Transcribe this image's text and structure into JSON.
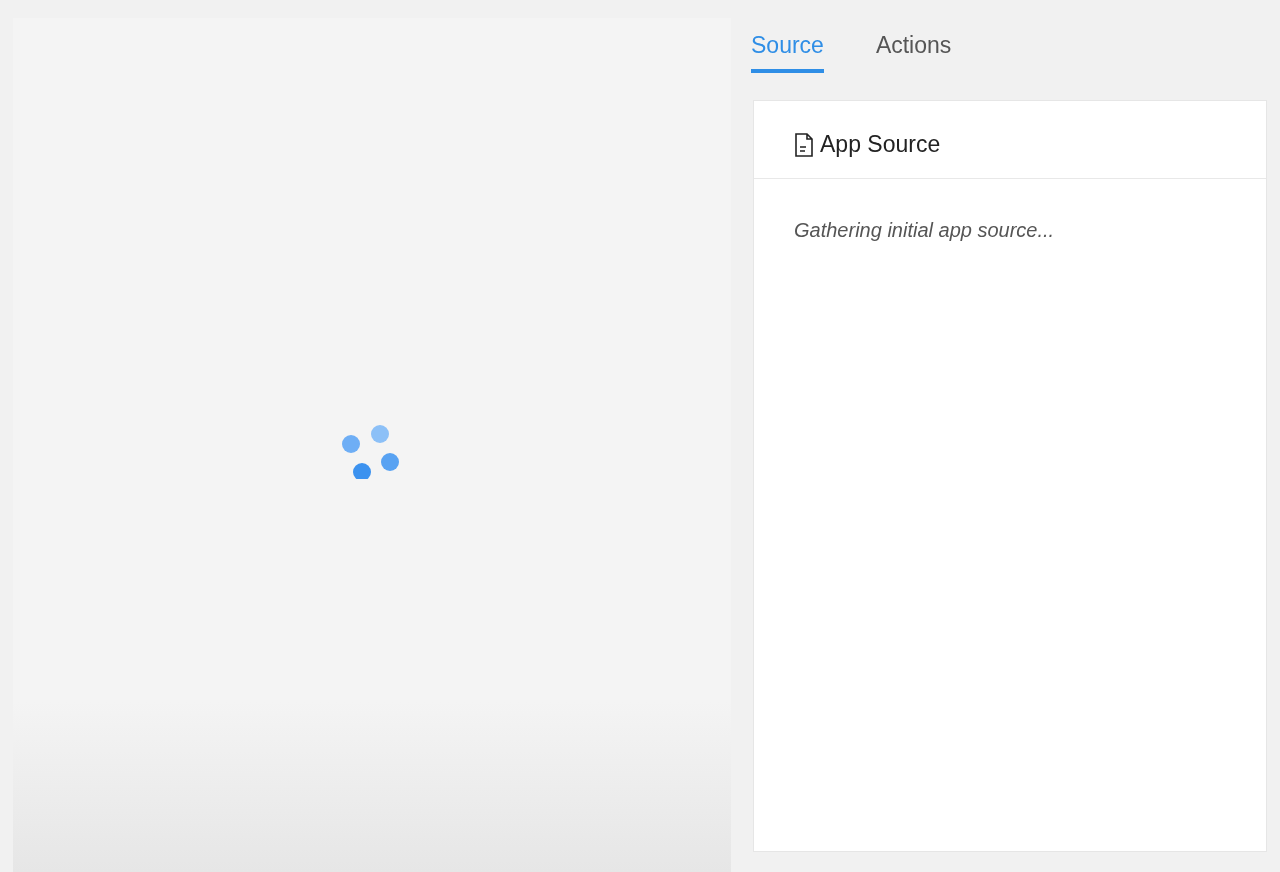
{
  "tabs": [
    {
      "label": "Source",
      "selected": true
    },
    {
      "label": "Actions",
      "selected": false
    }
  ],
  "source_panel": {
    "title": "App Source",
    "message": "Gathering initial app source..."
  }
}
